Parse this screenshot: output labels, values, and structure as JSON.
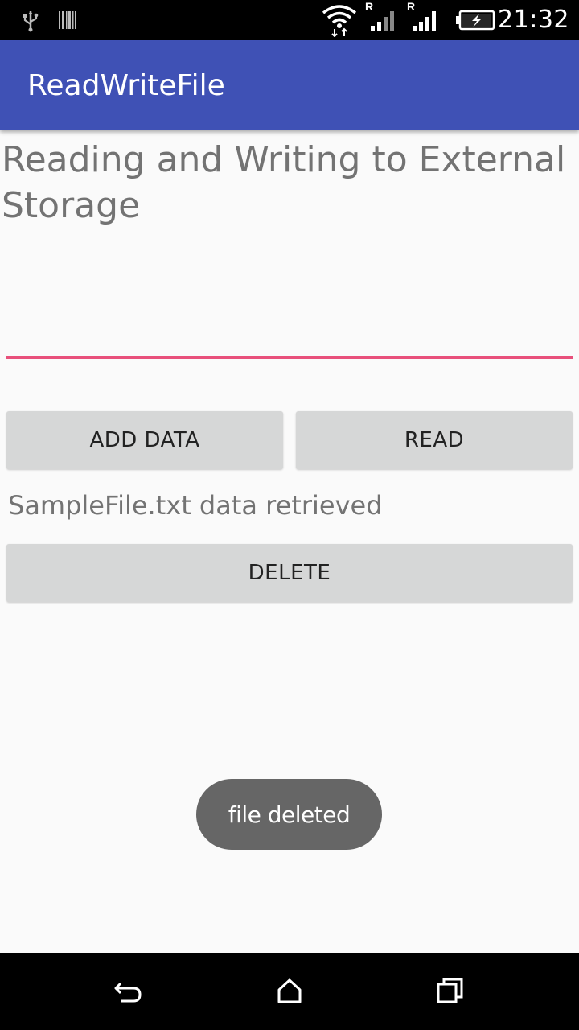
{
  "status_bar": {
    "time": "21:32",
    "icons": [
      "usb-icon",
      "barcode-icon",
      "wifi-icon",
      "signal-icon",
      "signal-icon",
      "battery-charging-icon"
    ],
    "roaming_label": "R"
  },
  "app_bar": {
    "title": "ReadWriteFile"
  },
  "main": {
    "heading": "Reading and Writing to External Storage",
    "input": {
      "value": "",
      "placeholder": ""
    },
    "add_button_label": "ADD DATA",
    "read_button_label": "READ",
    "status_text": "SampleFile.txt data retrieved",
    "delete_button_label": "DELETE"
  },
  "toast": {
    "message": "file deleted"
  },
  "nav_bar": {
    "icons": [
      "back-icon",
      "home-icon",
      "recents-icon"
    ]
  },
  "colors": {
    "app_bar": "#3f51b5",
    "accent": "#e8507b",
    "button": "#d6d7d7",
    "toast": "#666666"
  }
}
